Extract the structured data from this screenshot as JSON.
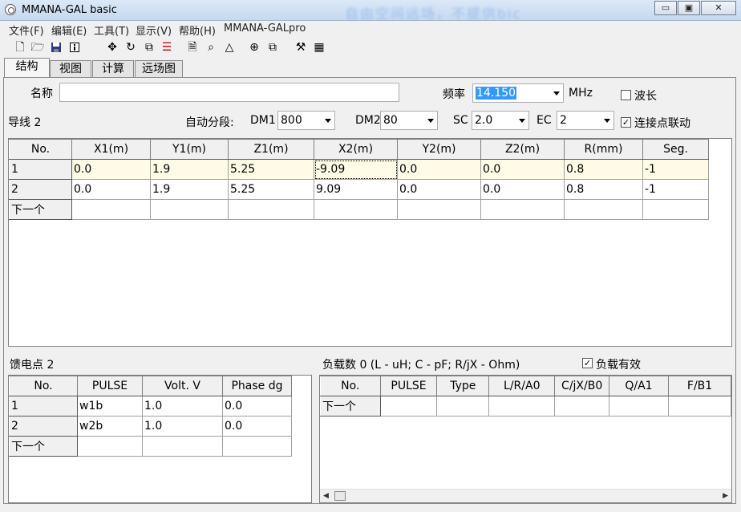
{
  "window": {
    "title": "MMANA-GAL basic",
    "blurred_banner": "自由空间远场，不提供bic",
    "buttons": {
      "minimize": "▭",
      "maximize": "▣",
      "close": "✕"
    }
  },
  "menu": [
    "文件(F)",
    "编辑(E)",
    "工具(T)",
    "显示(V)",
    "帮助(H)",
    "MMANA-GALpro"
  ],
  "toolbar_icons": [
    "new-file-icon",
    "open-folder-icon",
    "save-icon",
    "info-icon",
    "move-icon",
    "rotate-icon",
    "scale-icon",
    "stack-icon",
    "document-icon",
    "lens-icon",
    "triangle-icon",
    "target-icon",
    "copy-icon",
    "tools-icon",
    "calculator-icon"
  ],
  "tabs": [
    "结构",
    "视图",
    "计算",
    "远场图"
  ],
  "geometry": {
    "name_label": "名称",
    "name_value": "",
    "freq_label": "频率",
    "freq_value": "14.150",
    "freq_unit": "MHz",
    "wavelength_label": "波长",
    "wavelength_checked": false,
    "wire_count_label": "导线 2",
    "autoseg_label": "自动分段:",
    "dm1_label": "DM1",
    "dm1_value": "800",
    "dm2_label": "DM2",
    "dm2_value": "80",
    "sc_label": "SC",
    "sc_value": "2.0",
    "ec_label": "EC",
    "ec_value": "2",
    "link_label": "连接点联动",
    "link_checked": true
  },
  "wires": {
    "headers": [
      "No.",
      "X1(m)",
      "Y1(m)",
      "Z1(m)",
      "X2(m)",
      "Y2(m)",
      "Z2(m)",
      "R(mm)",
      "Seg."
    ],
    "rows": [
      [
        "1",
        "0.0",
        "1.9",
        "5.25",
        "-9.09",
        "0.0",
        "0.0",
        "0.8",
        "-1"
      ],
      [
        "2",
        "0.0",
        "1.9",
        "5.25",
        "9.09",
        "0.0",
        "0.0",
        "0.8",
        "-1"
      ],
      [
        "下一个",
        "",
        "",
        "",
        "",
        "",
        "",
        "",
        ""
      ]
    ]
  },
  "sources": {
    "label": "馈电点 2",
    "headers": [
      "No.",
      "PULSE",
      "Volt. V",
      "Phase dg"
    ],
    "rows": [
      [
        "1",
        "w1b",
        "1.0",
        "0.0"
      ],
      [
        "2",
        "w2b",
        "1.0",
        "0.0"
      ],
      [
        "下一个",
        "",
        "",
        ""
      ]
    ]
  },
  "loads": {
    "label": "负载数 0 (L - uH; C - pF; R/jX - Ohm)",
    "enabled_label": "负载有效",
    "enabled_checked": true,
    "headers": [
      "No.",
      "PULSE",
      "Type",
      "L/R/A0",
      "C/jX/B0",
      "Q/A1",
      "F/B1"
    ],
    "rows": [
      [
        "下一个",
        "",
        "",
        "",
        "",
        "",
        ""
      ]
    ]
  }
}
